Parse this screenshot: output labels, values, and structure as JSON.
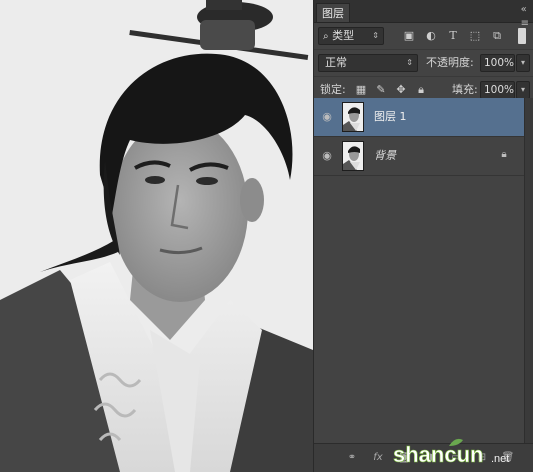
{
  "panel": {
    "tab_label": "图层",
    "menu_icon": "panel-menu-icon",
    "filter": {
      "label": "类型"
    },
    "filter_icons": [
      "image-filter-icon",
      "adjustment-filter-icon",
      "type-filter-icon",
      "shape-filter-icon",
      "smart-object-filter-icon"
    ],
    "blend_mode": "正常",
    "opacity": {
      "label": "不透明度:",
      "value": "100%"
    },
    "lock": {
      "label": "锁定:",
      "icons": [
        "lock-transparent-icon",
        "lock-paint-icon",
        "lock-move-icon",
        "lock-all-icon"
      ]
    },
    "fill": {
      "label": "填充:",
      "value": "100%"
    },
    "layers": [
      {
        "name": "图层 1",
        "active": true
      },
      {
        "name": "背景",
        "active": false,
        "locked": true
      }
    ],
    "footer_icons": [
      "link-layers-icon",
      "fx-icon",
      "layer-mask-icon",
      "adjustment-layer-icon",
      "group-icon",
      "new-layer-icon",
      "trash-icon"
    ]
  },
  "colors": {
    "panel_bg": "#434343",
    "active_layer": "#55708f",
    "text": "#d6d6d6"
  },
  "watermark": {
    "text_main": "shancun",
    "text_suffix": ".net"
  }
}
